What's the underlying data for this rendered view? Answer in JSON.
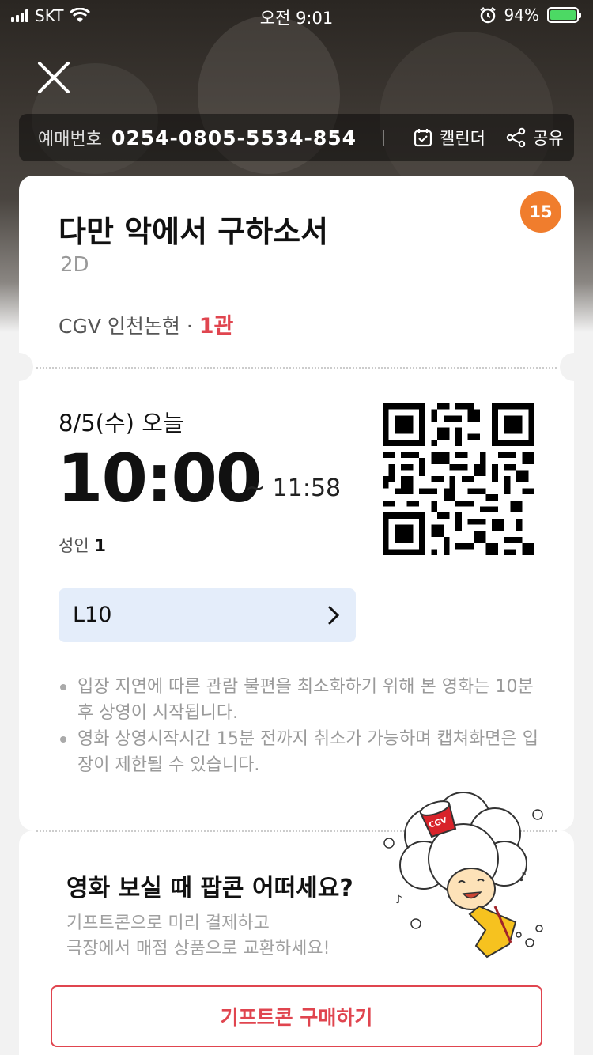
{
  "status_bar": {
    "carrier": "SKT",
    "time": "오전 9:01",
    "battery": "94%"
  },
  "header": {
    "booking_label": "예매번호",
    "booking_number": "0254-0805-5534-854",
    "calendar_label": "캘린더",
    "share_label": "공유"
  },
  "ticket": {
    "age_rating": "15",
    "title": "다만 악에서 구하소서",
    "format": "2D",
    "theater": "CGV 인천논현 · ",
    "hall": "1관",
    "date": "8/5(수) 오늘",
    "start_time": "10:00",
    "end_time": "~ 11:58",
    "audience_label": "성인",
    "audience_count": "1",
    "seat": "L10",
    "notices": [
      "입장 지연에 따른 관람 불편을 최소화하기 위해 본 영화는 10분 후 상영이 시작됩니다.",
      "영화 상영시작시간 15분 전까지 취소가 가능하며 캡쳐화면은 입장이 제한될 수 있습니다."
    ]
  },
  "promo": {
    "title": "영화 보실 때 팝콘 어떠세요?",
    "desc_line1": "기프트콘으로 미리 결제하고",
    "desc_line2": "극장에서 매점 상품으로 교환하세요!",
    "button_label": "기프트콘 구매하기",
    "mascot_text": "CGV"
  },
  "colors": {
    "accent_red": "#e0454f",
    "age_badge": "#f07d2d",
    "seat_bg": "#e4edfa"
  }
}
